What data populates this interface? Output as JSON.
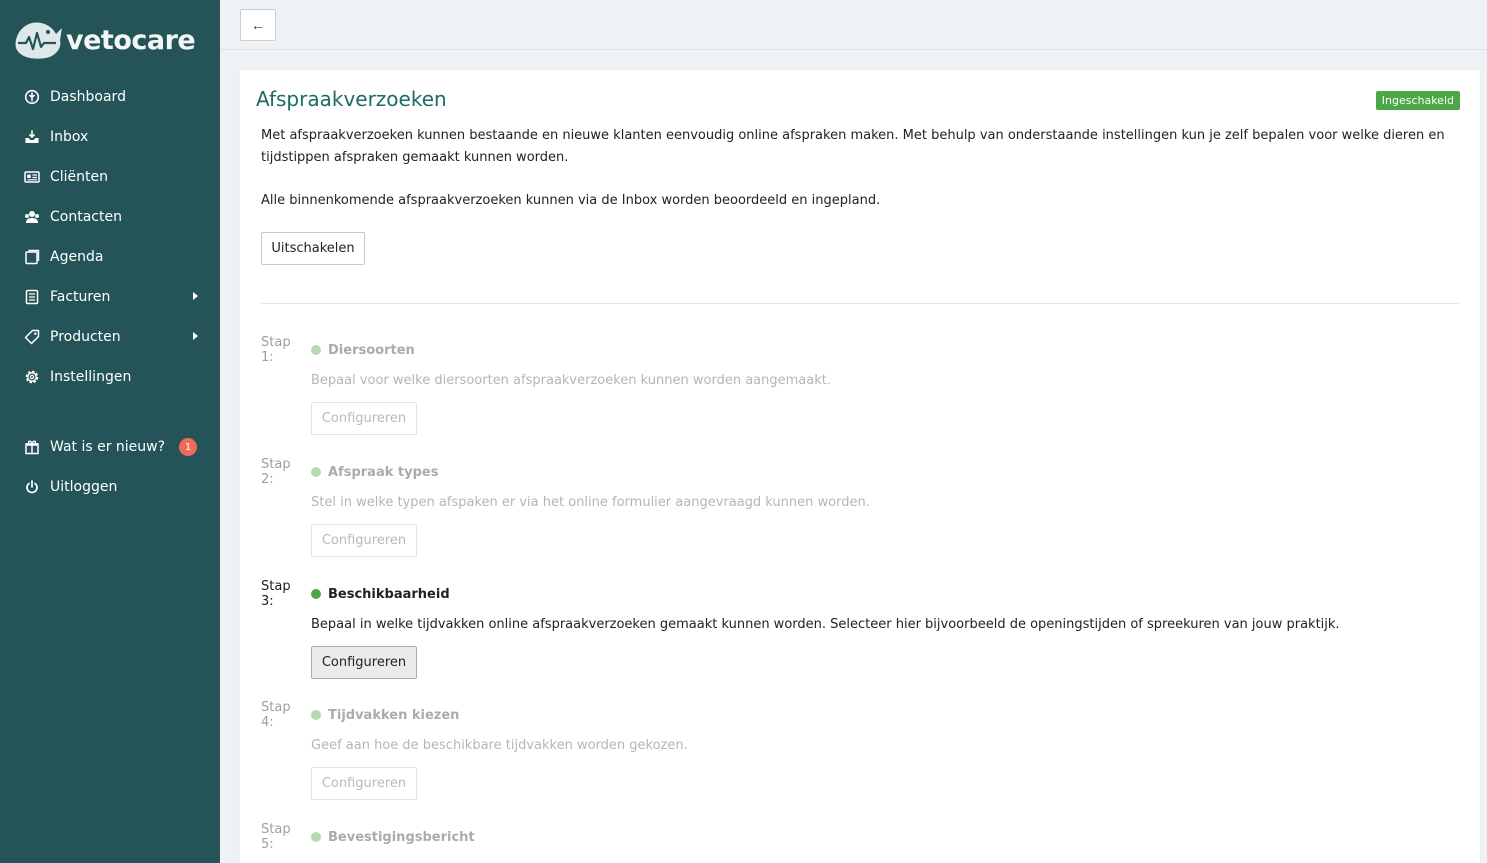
{
  "brand": {
    "name": "vetocare"
  },
  "sidebar": {
    "items": [
      {
        "label": "Dashboard",
        "icon": "dashboard-icon"
      },
      {
        "label": "Inbox",
        "icon": "inbox-icon"
      },
      {
        "label": "Cliënten",
        "icon": "clients-icon"
      },
      {
        "label": "Contacten",
        "icon": "contacts-icon"
      },
      {
        "label": "Agenda",
        "icon": "agenda-icon"
      },
      {
        "label": "Facturen",
        "icon": "invoices-icon",
        "has_submenu": true
      },
      {
        "label": "Producten",
        "icon": "products-icon",
        "has_submenu": true
      },
      {
        "label": "Instellingen",
        "icon": "settings-icon"
      }
    ],
    "secondary": [
      {
        "label": "Wat is er nieuw?",
        "icon": "gift-icon",
        "badge": "1"
      },
      {
        "label": "Uitloggen",
        "icon": "power-icon"
      }
    ]
  },
  "topbar": {
    "back_label": "←"
  },
  "page": {
    "title": "Afspraakverzoeken",
    "status": "Ingeschakeld",
    "intro": "Met afspraakverzoeken kunnen bestaande en nieuwe klanten eenvoudig online afspraken maken. Met behulp van onderstaande instellingen kun je zelf bepalen voor welke dieren en tijdstippen afspraken gemaakt kunnen worden.",
    "intro2": "Alle binnenkomende afspraakverzoeken kunnen via de Inbox worden beoordeeld en ingepland.",
    "disable_label": "Uitschakelen"
  },
  "steps": [
    {
      "num": "Stap 1:",
      "name": "Diersoorten",
      "desc": "Bepaal voor welke diersoorten afspraakverzoeken kunnen worden aangemaakt.",
      "button": "Configureren",
      "active": false
    },
    {
      "num": "Stap 2:",
      "name": "Afspraak types",
      "desc": "Stel in welke typen afspaken er via het online formulier aangevraagd kunnen worden.",
      "button": "Configureren",
      "active": false
    },
    {
      "num": "Stap 3:",
      "name": "Beschikbaarheid",
      "desc": "Bepaal in welke tijdvakken online afspraakverzoeken gemaakt kunnen worden. Selecteer hier bijvoorbeeld de openingstijden of spreekuren van jouw praktijk.",
      "button": "Configureren",
      "active": true
    },
    {
      "num": "Stap 4:",
      "name": "Tijdvakken kiezen",
      "desc": "Geef aan hoe de beschikbare tijdvakken worden gekozen.",
      "button": "Configureren",
      "active": false
    },
    {
      "num": "Stap 5:",
      "name": "Bevestigingsbericht",
      "active": false
    }
  ],
  "colors": {
    "sidebar": "#245457",
    "accent_title": "#1f6b62",
    "status_green": "#4ca846",
    "badge_red": "#ee6b5b"
  }
}
